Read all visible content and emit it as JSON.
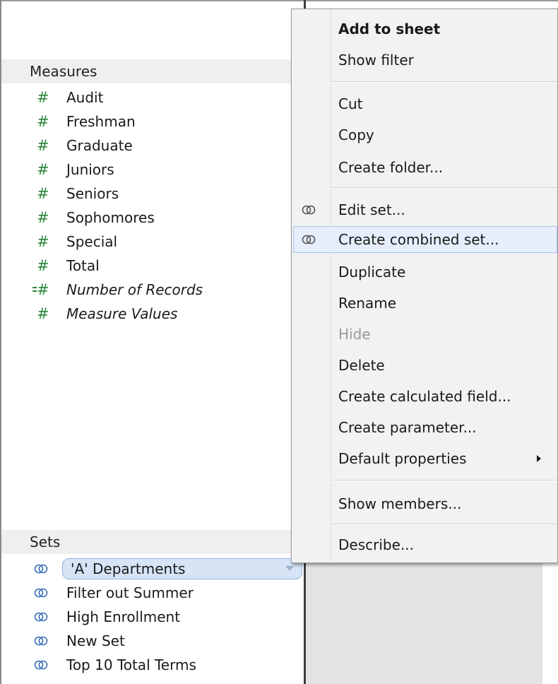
{
  "measures": {
    "header": "Measures",
    "items": [
      {
        "label": "Audit",
        "icon": "hash-icon"
      },
      {
        "label": "Freshman",
        "icon": "hash-icon"
      },
      {
        "label": "Graduate",
        "icon": "hash-icon"
      },
      {
        "label": "Juniors",
        "icon": "hash-icon"
      },
      {
        "label": "Seniors",
        "icon": "hash-icon"
      },
      {
        "label": "Sophomores",
        "icon": "hash-icon"
      },
      {
        "label": "Special",
        "icon": "hash-icon"
      },
      {
        "label": "Total",
        "icon": "hash-icon"
      },
      {
        "label": "Number of Records",
        "icon": "hash-equals-icon",
        "italic": true
      },
      {
        "label": "Measure Values",
        "icon": "hash-icon",
        "italic": true
      }
    ]
  },
  "sets": {
    "header": "Sets",
    "items": [
      {
        "label": "'A' Departments",
        "icon": "set-icon",
        "selected": true
      },
      {
        "label": "Filter out Summer",
        "icon": "set-icon"
      },
      {
        "label": "High Enrollment",
        "icon": "set-icon"
      },
      {
        "label": "New Set",
        "icon": "set-icon"
      },
      {
        "label": "Top 10 Total Terms",
        "icon": "set-icon"
      }
    ]
  },
  "context_menu": {
    "items": [
      {
        "label": "Add to sheet",
        "bold": true
      },
      {
        "label": "Show filter"
      },
      {
        "label": "Cut"
      },
      {
        "label": "Copy"
      },
      {
        "label": "Create folder..."
      },
      {
        "label": "Edit set...",
        "icon": "set-icon"
      },
      {
        "label": "Create combined set...",
        "icon": "set-icon",
        "hover": true
      },
      {
        "label": "Duplicate"
      },
      {
        "label": "Rename"
      },
      {
        "label": "Hide",
        "disabled": true
      },
      {
        "label": "Delete"
      },
      {
        "label": "Create calculated field..."
      },
      {
        "label": "Create parameter..."
      },
      {
        "label": "Default properties",
        "submenu": true
      },
      {
        "label": "Show members..."
      },
      {
        "label": "Describe..."
      }
    ]
  },
  "colors": {
    "measure_icon": "#2c8a3c",
    "set_icon": "#3a6fb8",
    "hover_highlight": "#e6eefb",
    "selected_pill": "#d6e4f6"
  }
}
